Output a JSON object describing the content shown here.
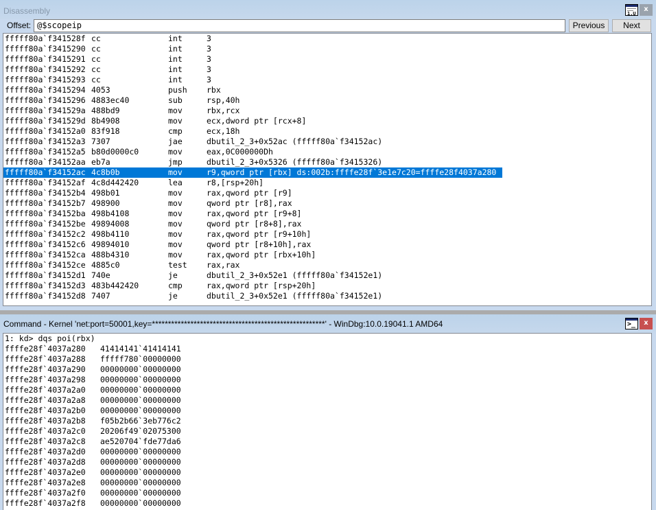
{
  "disassembly": {
    "title": "Disassembly",
    "offset_label": "Offset:",
    "offset_value": "@$scopeip",
    "previous_label": "Previous",
    "next_label": "Next",
    "close_label": "x",
    "selected_index": 13,
    "lines": [
      {
        "addr": "fffff80a`f341528f",
        "bytes": "cc",
        "mnem": "int",
        "ops": "3"
      },
      {
        "addr": "fffff80a`f3415290",
        "bytes": "cc",
        "mnem": "int",
        "ops": "3"
      },
      {
        "addr": "fffff80a`f3415291",
        "bytes": "cc",
        "mnem": "int",
        "ops": "3"
      },
      {
        "addr": "fffff80a`f3415292",
        "bytes": "cc",
        "mnem": "int",
        "ops": "3"
      },
      {
        "addr": "fffff80a`f3415293",
        "bytes": "cc",
        "mnem": "int",
        "ops": "3"
      },
      {
        "addr": "fffff80a`f3415294",
        "bytes": "4053",
        "mnem": "push",
        "ops": "rbx"
      },
      {
        "addr": "fffff80a`f3415296",
        "bytes": "4883ec40",
        "mnem": "sub",
        "ops": "rsp,40h"
      },
      {
        "addr": "fffff80a`f341529a",
        "bytes": "488bd9",
        "mnem": "mov",
        "ops": "rbx,rcx"
      },
      {
        "addr": "fffff80a`f341529d",
        "bytes": "8b4908",
        "mnem": "mov",
        "ops": "ecx,dword ptr [rcx+8]"
      },
      {
        "addr": "fffff80a`f34152a0",
        "bytes": "83f918",
        "mnem": "cmp",
        "ops": "ecx,18h"
      },
      {
        "addr": "fffff80a`f34152a3",
        "bytes": "7307",
        "mnem": "jae",
        "ops": "dbutil_2_3+0x52ac (fffff80a`f34152ac)"
      },
      {
        "addr": "fffff80a`f34152a5",
        "bytes": "b80d0000c0",
        "mnem": "mov",
        "ops": "eax,0C000000Dh"
      },
      {
        "addr": "fffff80a`f34152aa",
        "bytes": "eb7a",
        "mnem": "jmp",
        "ops": "dbutil_2_3+0x5326 (fffff80a`f3415326)"
      },
      {
        "addr": "fffff80a`f34152ac",
        "bytes": "4c8b0b",
        "mnem": "mov",
        "ops": "r9,qword ptr [rbx] ds:002b:ffffe28f`3e1e7c20=ffffe28f4037a280"
      },
      {
        "addr": "fffff80a`f34152af",
        "bytes": "4c8d442420",
        "mnem": "lea",
        "ops": "r8,[rsp+20h]"
      },
      {
        "addr": "fffff80a`f34152b4",
        "bytes": "498b01",
        "mnem": "mov",
        "ops": "rax,qword ptr [r9]"
      },
      {
        "addr": "fffff80a`f34152b7",
        "bytes": "498900",
        "mnem": "mov",
        "ops": "qword ptr [r8],rax"
      },
      {
        "addr": "fffff80a`f34152ba",
        "bytes": "498b4108",
        "mnem": "mov",
        "ops": "rax,qword ptr [r9+8]"
      },
      {
        "addr": "fffff80a`f34152be",
        "bytes": "49894008",
        "mnem": "mov",
        "ops": "qword ptr [r8+8],rax"
      },
      {
        "addr": "fffff80a`f34152c2",
        "bytes": "498b4110",
        "mnem": "mov",
        "ops": "rax,qword ptr [r9+10h]"
      },
      {
        "addr": "fffff80a`f34152c6",
        "bytes": "49894010",
        "mnem": "mov",
        "ops": "qword ptr [r8+10h],rax"
      },
      {
        "addr": "fffff80a`f34152ca",
        "bytes": "488b4310",
        "mnem": "mov",
        "ops": "rax,qword ptr [rbx+10h]"
      },
      {
        "addr": "fffff80a`f34152ce",
        "bytes": "4885c0",
        "mnem": "test",
        "ops": "rax,rax"
      },
      {
        "addr": "fffff80a`f34152d1",
        "bytes": "740e",
        "mnem": "je",
        "ops": "dbutil_2_3+0x52e1 (fffff80a`f34152e1)"
      },
      {
        "addr": "fffff80a`f34152d3",
        "bytes": "483b442420",
        "mnem": "cmp",
        "ops": "rax,qword ptr [rsp+20h]"
      },
      {
        "addr": "fffff80a`f34152d8",
        "bytes": "7407",
        "mnem": "je",
        "ops": "dbutil_2_3+0x52e1 (fffff80a`f34152e1)"
      }
    ]
  },
  "command": {
    "title": "Command - Kernel 'net:port=50001,key=******************************************************' - WinDbg:10.0.19041.1 AMD64",
    "close_label": "x",
    "prompt_line": "1: kd> dqs poi(rbx)",
    "memory": [
      {
        "addr": "ffffe28f`4037a280",
        "val": "41414141`41414141"
      },
      {
        "addr": "ffffe28f`4037a288",
        "val": "fffff780`00000000"
      },
      {
        "addr": "ffffe28f`4037a290",
        "val": "00000000`00000000"
      },
      {
        "addr": "ffffe28f`4037a298",
        "val": "00000000`00000000"
      },
      {
        "addr": "ffffe28f`4037a2a0",
        "val": "00000000`00000000"
      },
      {
        "addr": "ffffe28f`4037a2a8",
        "val": "00000000`00000000"
      },
      {
        "addr": "ffffe28f`4037a2b0",
        "val": "00000000`00000000"
      },
      {
        "addr": "ffffe28f`4037a2b8",
        "val": "f05b2b66`3eb776c2"
      },
      {
        "addr": "ffffe28f`4037a2c0",
        "val": "20206f49`02075300"
      },
      {
        "addr": "ffffe28f`4037a2c8",
        "val": "ae520704`fde77da6"
      },
      {
        "addr": "ffffe28f`4037a2d0",
        "val": "00000000`00000000"
      },
      {
        "addr": "ffffe28f`4037a2d8",
        "val": "00000000`00000000"
      },
      {
        "addr": "ffffe28f`4037a2e0",
        "val": "00000000`00000000"
      },
      {
        "addr": "ffffe28f`4037a2e8",
        "val": "00000000`00000000"
      },
      {
        "addr": "ffffe28f`4037a2f0",
        "val": "00000000`00000000"
      },
      {
        "addr": "ffffe28f`4037a2f8",
        "val": "00000000`00000000"
      }
    ]
  }
}
